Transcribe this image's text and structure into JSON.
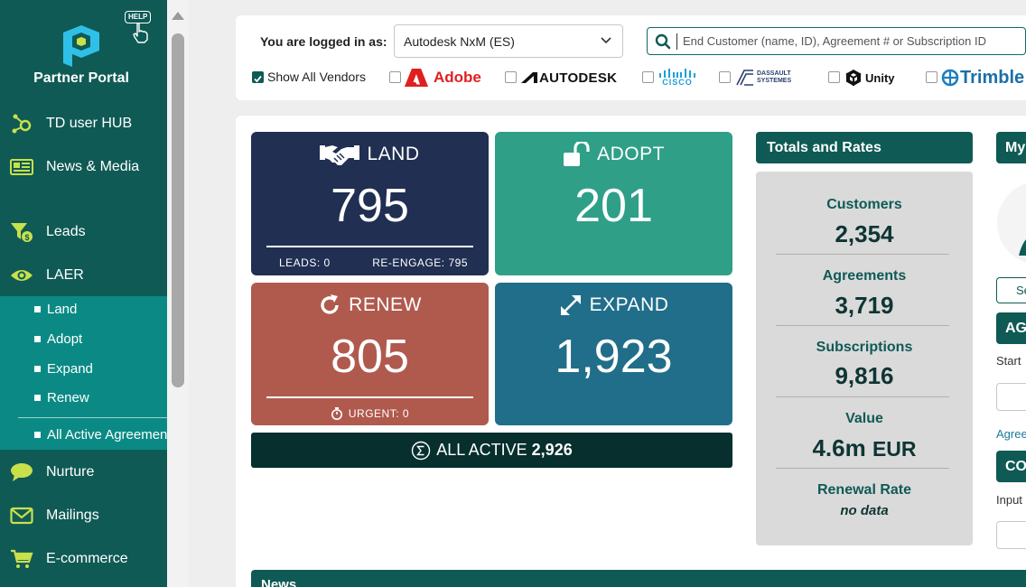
{
  "brand": {
    "name": "Partner Portal",
    "help_label": "HELP",
    "logo_color": "#2fc0e8"
  },
  "sidebar": {
    "items": [
      {
        "label": "TD user HUB",
        "icon": "hub-icon"
      },
      {
        "label": "News & Media",
        "icon": "newspaper-icon"
      },
      {
        "label": "Leads",
        "icon": "funnel-dollar-icon"
      },
      {
        "label": "LAER",
        "icon": "eye-icon"
      },
      {
        "label": "Nurture",
        "icon": "chat-bubble-icon"
      },
      {
        "label": "Mailings",
        "icon": "envelope-icon"
      },
      {
        "label": "E-commerce",
        "icon": "cart-icon"
      }
    ],
    "laer_submenu": [
      "Land",
      "Adopt",
      "Expand",
      "Renew",
      "All Active Agreements"
    ],
    "accent_icon_color": "#c8e04a"
  },
  "header": {
    "logged_in_label": "You are logged in as:",
    "account_selected": "Autodesk NxM (ES)",
    "search_placeholder": "End Customer (name, ID), Agreement # or Subscription ID",
    "show_all_vendors_label": "Show All Vendors",
    "vendors": [
      "Adobe",
      "AUTODESK",
      "CISCO",
      "DASSAULT SYSTEMES",
      "Unity",
      "Trimble"
    ]
  },
  "tiles": {
    "land": {
      "title": "LAND",
      "value": "795",
      "leads_label": "LEADS:",
      "leads_value": "0",
      "reengage_label": "RE-ENGAGE:",
      "reengage_value": "795",
      "color": "#202f52"
    },
    "adopt": {
      "title": "ADOPT",
      "value": "201",
      "color": "#2fa087"
    },
    "renew": {
      "title": "RENEW",
      "value": "805",
      "urgent_label": "URGENT:",
      "urgent_value": "0",
      "color": "#b05a4e"
    },
    "expand": {
      "title": "EXPAND",
      "value": "1,923",
      "color": "#216e8a"
    },
    "all_active": {
      "label": "ALL ACTIVE",
      "value": "2,926"
    }
  },
  "totals": {
    "title": "Totals and Rates",
    "customers_label": "Customers",
    "customers_value": "2,354",
    "agreements_label": "Agreements",
    "agreements_value": "3,719",
    "subscriptions_label": "Subscriptions",
    "subscriptions_value": "9,816",
    "value_label": "Value",
    "value_value": "4.6m",
    "value_currency": "EUR",
    "renewal_label": "Renewal Rate",
    "renewal_value": "no data"
  },
  "news": {
    "title": "News"
  },
  "right_column": {
    "header": "My",
    "button": "Se",
    "section1": "AG",
    "section1_text": "Start",
    "section1_link": "Agree",
    "section2": "CO",
    "section2_text": "Input"
  }
}
